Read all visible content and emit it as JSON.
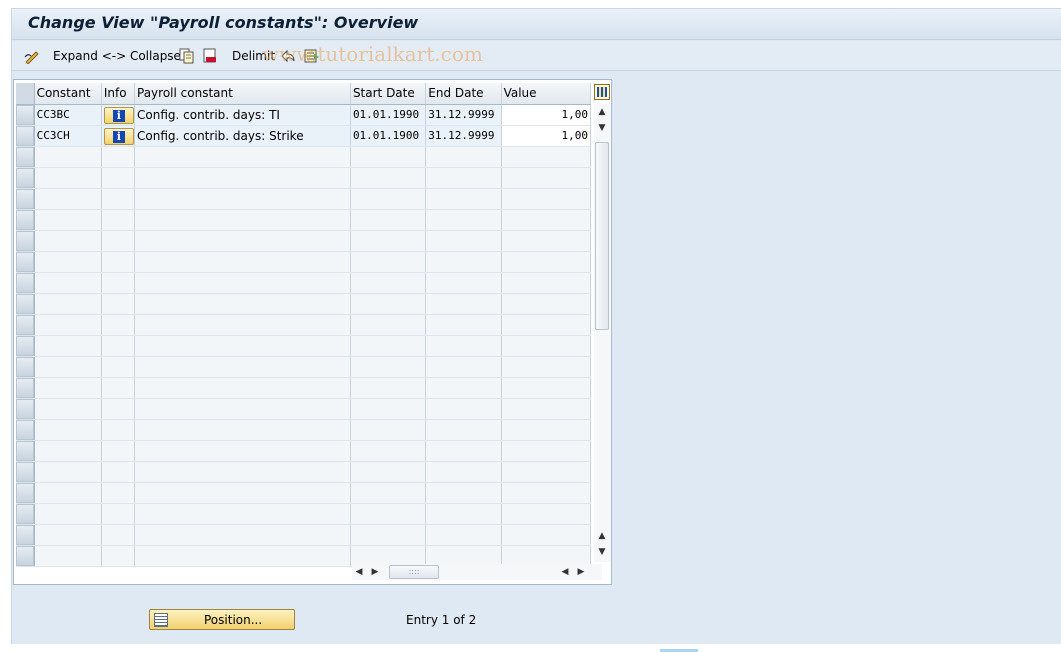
{
  "window": {
    "title": "Change View \"Payroll constants\": Overview"
  },
  "toolbar": {
    "expand_collapse_label": "Expand <-> Collapse",
    "delimit_label": "Delimit",
    "watermark": "www.tutorialkart.com"
  },
  "table": {
    "headers": {
      "constant": "Constant",
      "info": "Info",
      "payroll_constant": "Payroll constant",
      "start_date": "Start Date",
      "end_date": "End Date",
      "value": "Value"
    },
    "rows": [
      {
        "constant": "CC3BC",
        "payroll_constant": "Config. contrib. days: TI",
        "start_date": "01.01.1990",
        "end_date": "31.12.9999",
        "value": "1,00"
      },
      {
        "constant": "CC3CH",
        "payroll_constant": "Config. contrib. days: Strike",
        "start_date": "01.01.1900",
        "end_date": "31.12.9999",
        "value": "1,00"
      }
    ]
  },
  "footer": {
    "position_button_label": "Position...",
    "entry_status": "Entry 1 of 2"
  },
  "colors": {
    "title_bg": "#d6e2ee",
    "button_yellow": "#f1d070",
    "info_icon": "#1446b4"
  }
}
